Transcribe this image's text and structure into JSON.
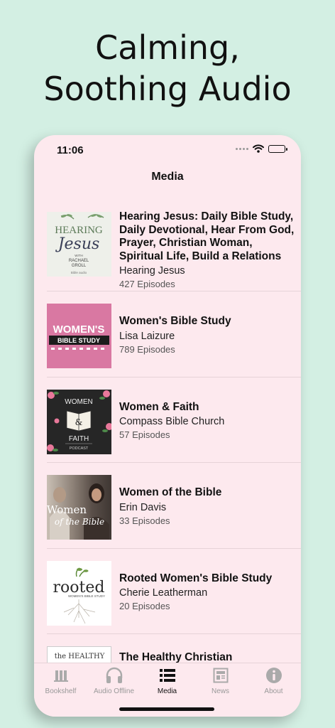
{
  "headline": {
    "line1": "Calming,",
    "line2": "Soothing Audio"
  },
  "status_bar": {
    "time": "11:06"
  },
  "nav": {
    "title": "Media"
  },
  "items": [
    {
      "title": "Hearing Jesus: Daily Bible Study, Daily Devotional, Hear From God, Prayer, Christian Woman, Spiritual Life, Build a Relations",
      "author": "Hearing Jesus",
      "episodes": "427 Episodes",
      "art": {
        "word1": "HEARING",
        "word2": "Jesus",
        "with": "WITH",
        "name1": "RACHAEL",
        "name2": "GROLL",
        "brand": "Bible audio"
      }
    },
    {
      "title": "Women's Bible Study",
      "author": "Lisa Laizure",
      "episodes": "789 Episodes",
      "art": {
        "line1": "WOMEN'S",
        "line2": "BIBLE STUDY"
      }
    },
    {
      "title": "Women & Faith",
      "author": "Compass Bible Church",
      "episodes": "57 Episodes",
      "art": {
        "top": "WOMEN",
        "amp": "&",
        "bottom": "FAITH",
        "sub": "PODCAST"
      }
    },
    {
      "title": "Women of the Bible",
      "author": "Erin Davis",
      "episodes": "33 Episodes",
      "art": {
        "line1": "Women",
        "line2": "of the Bible"
      }
    },
    {
      "title": "Rooted Women's Bible Study",
      "author": "Cherie Leatherman",
      "episodes": "20 Episodes",
      "art": {
        "word": "rooted",
        "sub": "WOMEN'S BIBLE STUDY"
      }
    },
    {
      "title": "The Healthy Christian",
      "author": "",
      "episodes": "",
      "art": {
        "word": "the HEALTHY"
      }
    }
  ],
  "tabs": [
    {
      "label": "Bookshelf",
      "icon": "bookshelf-icon",
      "active": false
    },
    {
      "label": "Audio Offline",
      "icon": "headphones-icon",
      "active": false
    },
    {
      "label": "Media",
      "icon": "list-icon",
      "active": true
    },
    {
      "label": "News",
      "icon": "newspaper-icon",
      "active": false
    },
    {
      "label": "About",
      "icon": "info-icon",
      "active": false
    }
  ],
  "colors": {
    "background": "#d3efe3",
    "screen": "#fde9ee",
    "accent_pink": "#e07aa3",
    "text": "#111111",
    "inactive": "#999999"
  }
}
